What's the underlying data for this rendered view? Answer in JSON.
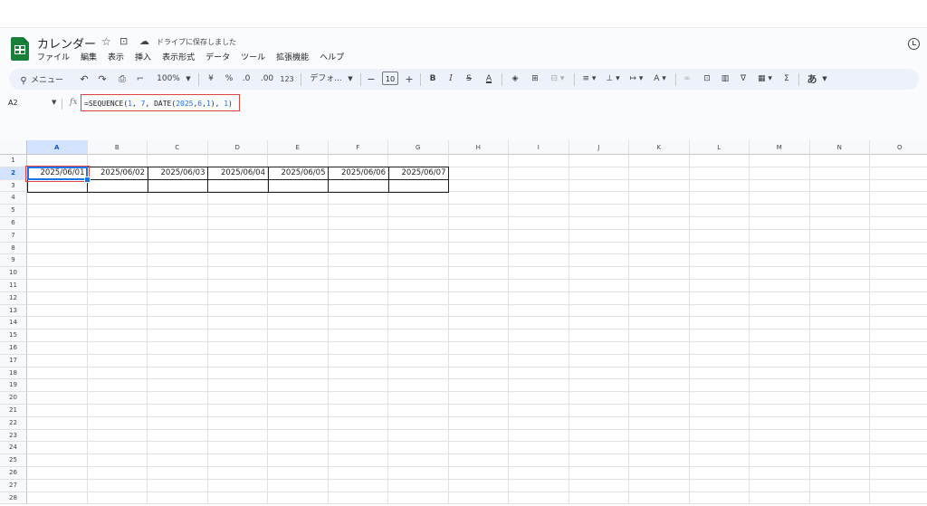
{
  "app": {
    "doc_title": "カレンダー",
    "saved_status": "ドライブに保存しました",
    "menu": [
      "ファイル",
      "編集",
      "表示",
      "挿入",
      "表示形式",
      "データ",
      "ツール",
      "拡張機能",
      "ヘルプ"
    ]
  },
  "toolbar": {
    "search_label": "メニュー",
    "zoom": "100%",
    "currency": "¥",
    "percent": "%",
    "dec_decrease": ".0",
    "dec_increase": ".00",
    "number_format": "123",
    "font": "デフォ...",
    "font_size": "10",
    "bold": "B",
    "italic": "I",
    "sum": "Σ",
    "input_mode": "あ"
  },
  "formula_bar": {
    "cell_ref": "A2",
    "fx": "fx",
    "formula_parts": [
      {
        "t": "=SEQUENCE(",
        "c": "plain"
      },
      {
        "t": "1",
        "c": "num"
      },
      {
        "t": ", ",
        "c": "plain"
      },
      {
        "t": "7",
        "c": "num"
      },
      {
        "t": ", DATE(",
        "c": "plain"
      },
      {
        "t": "2025",
        "c": "num"
      },
      {
        "t": ",",
        "c": "plain"
      },
      {
        "t": "6",
        "c": "num"
      },
      {
        "t": ",",
        "c": "plain"
      },
      {
        "t": "1",
        "c": "num"
      },
      {
        "t": "), ",
        "c": "plain"
      },
      {
        "t": "1",
        "c": "num"
      },
      {
        "t": ")",
        "c": "plain"
      }
    ]
  },
  "sheet": {
    "columns": [
      "A",
      "B",
      "C",
      "D",
      "E",
      "F",
      "G",
      "H",
      "I",
      "J",
      "K",
      "L",
      "M",
      "N",
      "O"
    ],
    "rows": [
      "1",
      "2",
      "3",
      "4",
      "5",
      "6",
      "7",
      "8",
      "9",
      "10",
      "11",
      "12",
      "13",
      "14",
      "15",
      "16",
      "17",
      "18",
      "19",
      "20",
      "21",
      "22",
      "23",
      "24",
      "25",
      "26",
      "27",
      "28"
    ],
    "active_cell": "A2",
    "row2_values": [
      "2025/06/01",
      "2025/06/02",
      "2025/06/03",
      "2025/06/04",
      "2025/06/05",
      "2025/06/06",
      "2025/06/07"
    ]
  },
  "colors": {
    "accent": "#1a73e8",
    "highlight_box": "#e0443e",
    "sheets_green": "#188038",
    "toolbar_bg": "#edf2fa"
  }
}
